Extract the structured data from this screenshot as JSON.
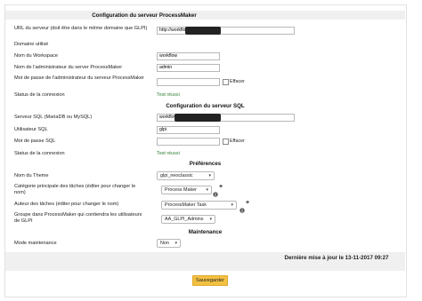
{
  "pm_config": {
    "title": "Configuration du serveur ProcessMaker",
    "url_label": "URL du serveur (doit être dans le même domaine que GLPI)",
    "url_value": "http://workflow",
    "domain_label": "Domaine utilisé",
    "workspace_label": "Nom du Workspace",
    "workspace_value": "workflow",
    "admin_label": "Nom de l'administrateur du server ProcessMaker",
    "admin_value": "admin",
    "password_label": "Mot de passe de l'administrateur du serveur ProcessMaker",
    "erase_label": "Effacer",
    "status_label": "Status de la connexion",
    "status_value": "Test réussi"
  },
  "sql_config": {
    "title": "Configuration du serveur SQL",
    "server_label": "Serveur SQL (MariaDB ou MySQL)",
    "server_value": "workflow",
    "user_label": "Utilisateur SQL",
    "user_value": "glpi",
    "password_label": "Mot de passe SQL",
    "erase_label": "Effacer",
    "status_label": "Status de la connexion",
    "status_value": "Test réussi"
  },
  "preferences": {
    "title": "Préférences",
    "theme_label": "Nom du Theme",
    "theme_value": "glpi_neoclassic",
    "category_label": "Catégorie principale des tâches (éditer pour changer le nom)",
    "category_value": "Process Maker",
    "author_label": "Auteur des tâches (éditer pour changer le nom)",
    "author_value": "ProcessMaker Task",
    "group_label": "Groupe dans ProcessMaker qui contiendra les utilisateurs de GLPI",
    "group_value": "AA_GLPI_Admins"
  },
  "maintenance": {
    "title": "Maintenance",
    "mode_label": "Mode maintenance",
    "mode_value": "Non"
  },
  "footer": {
    "last_update": "Dernière mise à jour le 13-11-2017 09:27",
    "save_label": "Sauvegarder"
  },
  "icons": {
    "info": "info-icon",
    "add": "plus-icon",
    "dropdown": "chevron-down-icon"
  }
}
